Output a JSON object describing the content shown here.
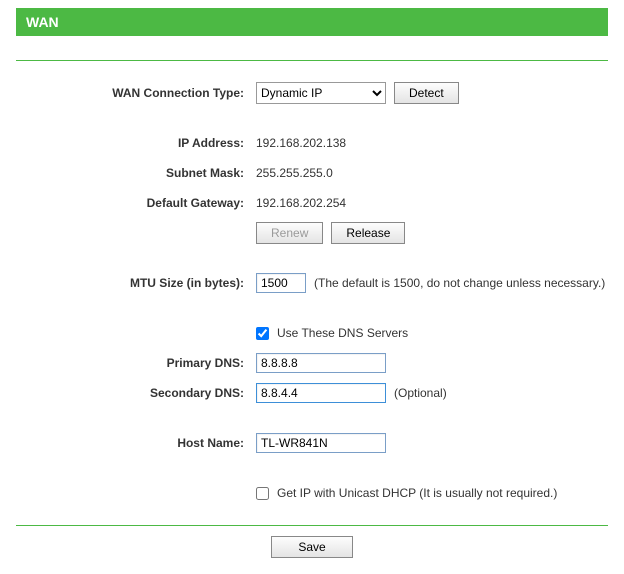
{
  "header": {
    "title": "WAN"
  },
  "wan": {
    "connection_type_label": "WAN Connection Type:",
    "connection_type_value": "Dynamic IP",
    "detect_label": "Detect",
    "ip_address_label": "IP Address:",
    "ip_address_value": "192.168.202.138",
    "subnet_mask_label": "Subnet Mask:",
    "subnet_mask_value": "255.255.255.0",
    "default_gateway_label": "Default Gateway:",
    "default_gateway_value": "192.168.202.254",
    "renew_label": "Renew",
    "release_label": "Release",
    "mtu_label": "MTU Size (in bytes):",
    "mtu_value": "1500",
    "mtu_hint": "(The default is 1500, do not change unless necessary.)",
    "use_dns_label": "Use These DNS Servers",
    "primary_dns_label": "Primary DNS:",
    "primary_dns_value": "8.8.8.8",
    "secondary_dns_label": "Secondary DNS:",
    "secondary_dns_value": "8.8.4.4",
    "secondary_dns_hint": "(Optional)",
    "host_name_label": "Host Name:",
    "host_name_value": "TL-WR841N",
    "unicast_dhcp_label": "Get IP with Unicast DHCP (It is usually not required.)",
    "save_label": "Save"
  }
}
